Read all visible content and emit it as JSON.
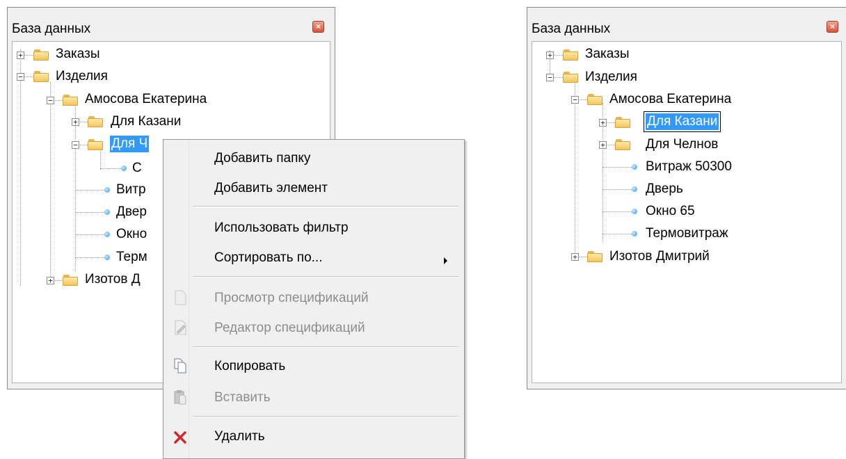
{
  "panel_left": {
    "title": "База данных",
    "tree": {
      "zakazy": "Заказы",
      "izdeliya": "Изделия",
      "amosova": "Амосова Екатерина",
      "kazan": "Для Казани",
      "cheln": "Для Ч",
      "item_c": "С",
      "vitr": "Витр",
      "dver": "Двер",
      "okno": "Окно",
      "term": "Терм",
      "izotov": "Изотов Д"
    }
  },
  "context_menu": {
    "add_folder": "Добавить папку",
    "add_element": "Добавить элемент",
    "use_filter": "Использовать фильтр",
    "sort_by": "Сортировать по...",
    "view_specs": "Просмотр спецификаций",
    "edit_specs": "Редактор спецификаций",
    "copy": "Копировать",
    "paste": "Вставить",
    "delete": "Удалить"
  },
  "panel_right": {
    "title": "База данных",
    "tree": {
      "zakazy": "Заказы",
      "izdeliya": "Изделия",
      "amosova": "Амосова Екатерина",
      "kazan_edit": "Для Казани",
      "cheln": "Для Челнов",
      "vitrazh": "Витраж 50300",
      "dver": "Дверь",
      "okno": "Окно 65",
      "term": "Термовитраж",
      "izotov": "Изотов Дмитрий"
    }
  },
  "icons": {
    "close": "close-icon",
    "folder": "folder-icon",
    "item": "item-dot-icon",
    "copy": "copy-icon",
    "paste": "paste-icon",
    "delete": "delete-x-icon",
    "submenu": "submenu-arrow-icon"
  },
  "colors": {
    "selection": "#3399ff",
    "delete_icon": "#cc2a2a",
    "close_button": "#d9533a"
  }
}
